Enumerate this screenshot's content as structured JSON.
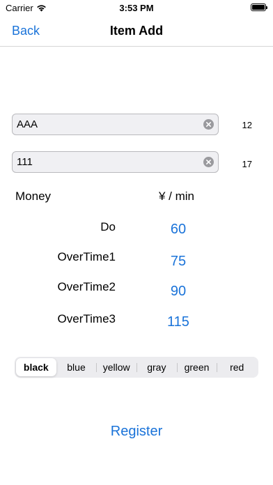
{
  "status_bar": {
    "carrier": "Carrier",
    "time": "3:53 PM"
  },
  "nav": {
    "back_label": "Back",
    "title": "Item Add"
  },
  "fields": [
    {
      "value": "AAA",
      "count": "12"
    },
    {
      "value": "111",
      "count": "17"
    }
  ],
  "money": {
    "label": "Money",
    "unit_label": "¥ / min",
    "rows": [
      {
        "label": "Do",
        "value": "60"
      },
      {
        "label": "OverTime1",
        "value": "75"
      },
      {
        "label": "OverTime2",
        "value": "90"
      },
      {
        "label": "OverTime3",
        "value": "115"
      }
    ]
  },
  "colors_segmented": {
    "options": [
      "black",
      "blue",
      "yellow",
      "gray",
      "green",
      "red"
    ],
    "selected": "black"
  },
  "register_label": "Register",
  "accent_color": "#1a73d9"
}
